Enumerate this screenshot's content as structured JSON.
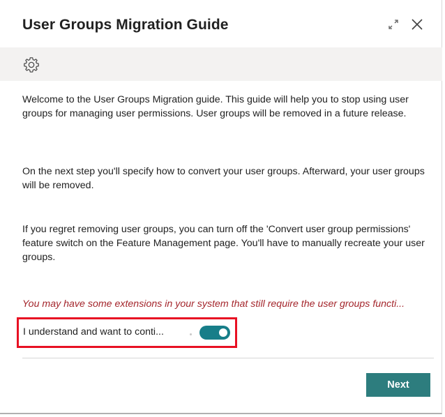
{
  "dialog": {
    "title": "User Groups Migration Guide",
    "expand_icon": "expand-icon",
    "close_icon": "close-icon"
  },
  "toolbar": {
    "settings_icon": "gear-icon"
  },
  "content": {
    "paragraphs": [
      "Welcome to the User Groups Migration guide. This guide will help you to stop using user groups for managing user permissions. User groups will be removed in a future release.",
      "On the next step you'll specify how to convert your user groups. Afterward, your user groups will be removed.",
      "If you regret removing user groups, you can turn off the 'Convert user group permissions' feature switch on the Feature Management page. You'll have to manually recreate your user groups."
    ],
    "warning": "You may have some extensions in your system that still require the user groups functi..."
  },
  "consent": {
    "label": "I understand and want to conti...",
    "toggle_on": true
  },
  "footer": {
    "next_label": "Next"
  },
  "colors": {
    "accent": "#2d7d7e",
    "toggle": "#177e89",
    "warning": "#a4262c",
    "highlight": "#e81123",
    "toolbar_bg": "#f3f2f1"
  }
}
